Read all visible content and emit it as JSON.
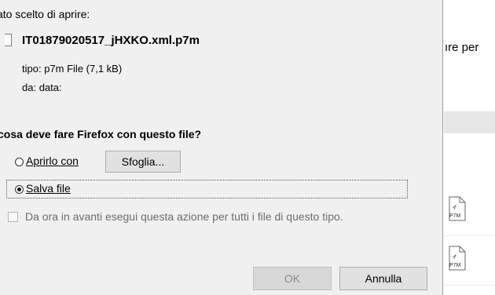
{
  "dialog": {
    "intro": "ato scelto di aprire:",
    "filename": "IT01879020517_jHXKO.xml.p7m",
    "type_label": "tipo:",
    "type_value": "p7m File (7,1 kB)",
    "from_label": "da:",
    "from_value": "data:",
    "question": "cosa deve fare Firefox con questo file?",
    "open_with_label": "Aprirlo con",
    "browse_label": "Sfoglia...",
    "save_file_label": "Salva file",
    "always_label": "Da ora in avanti esegui questa azione per tutti i file di questo tipo.",
    "ok_label": "OK",
    "cancel_label": "Annulla",
    "selected_option": "save-file"
  },
  "background": {
    "text_fragment": "ıre per",
    "file_icon_label": "P7M"
  }
}
